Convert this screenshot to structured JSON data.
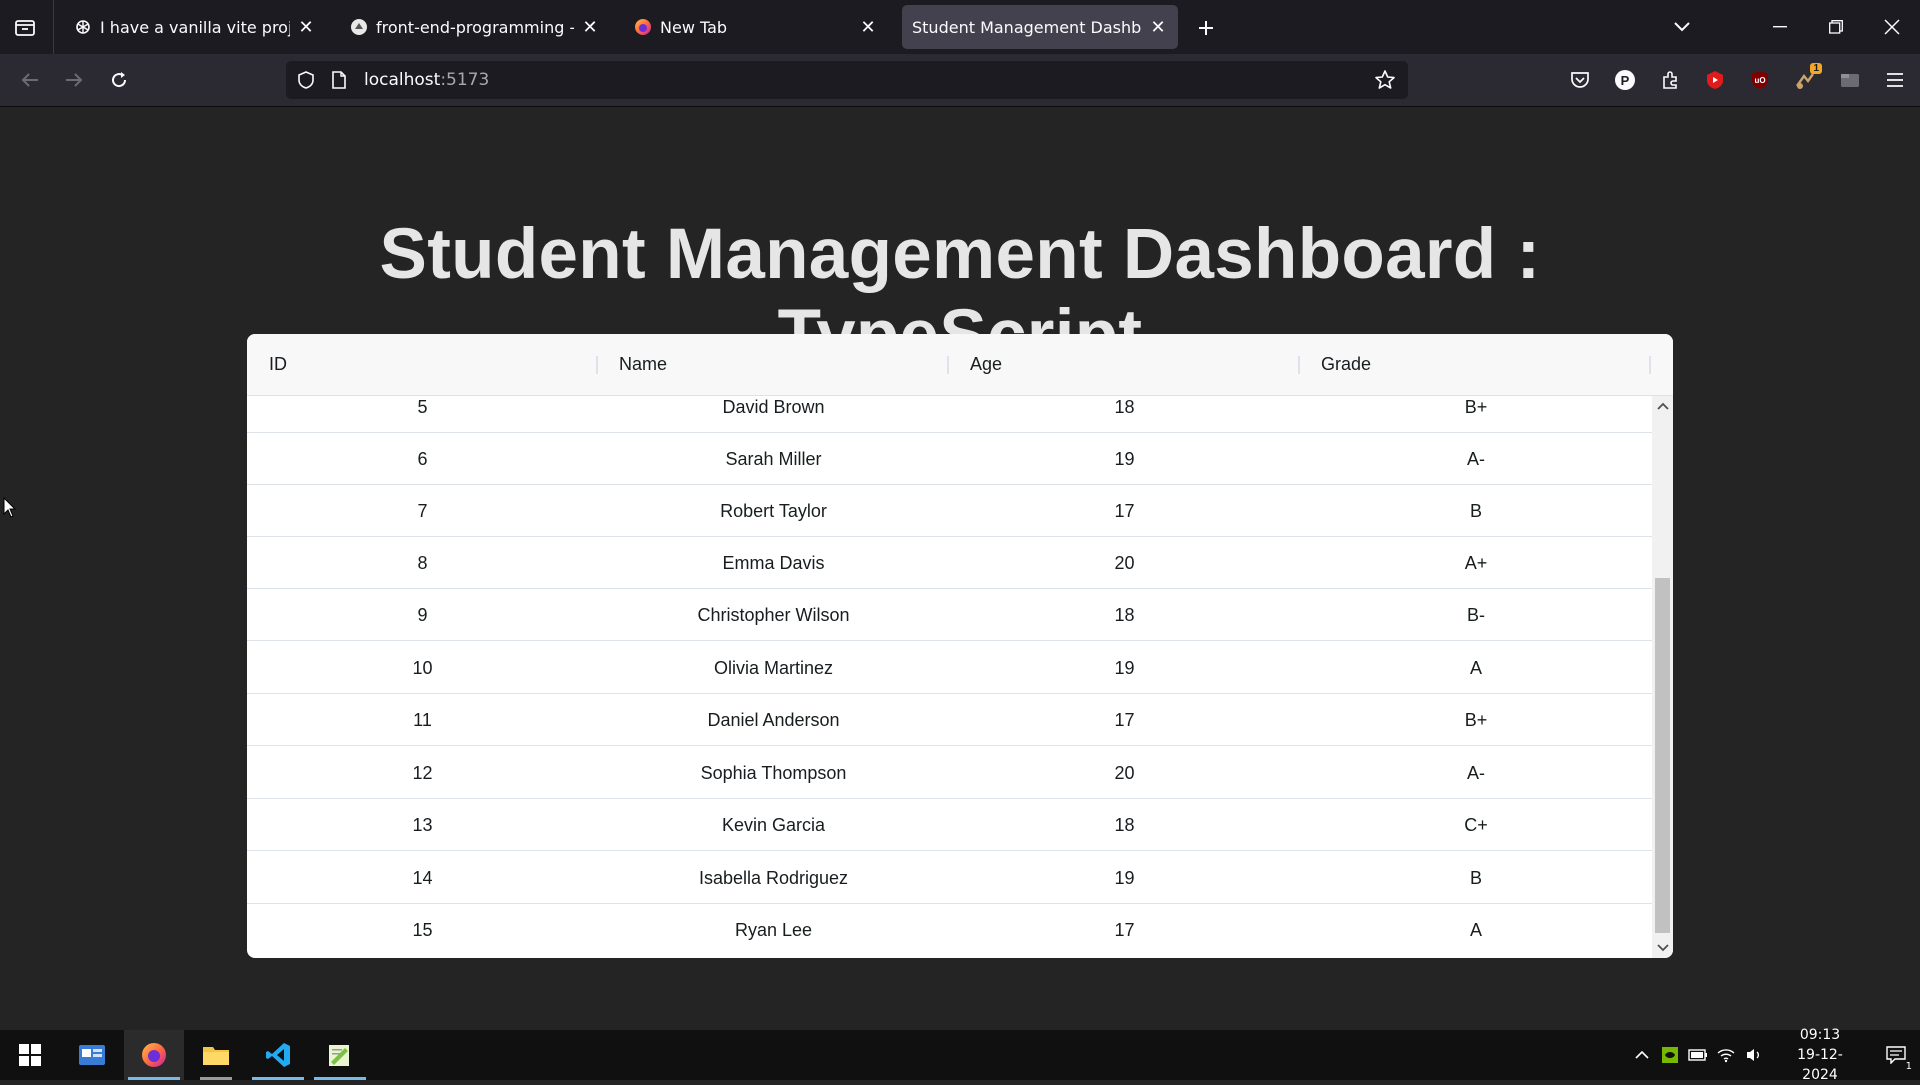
{
  "browser": {
    "tabs": [
      {
        "title": "I have a vanilla vite project. I have",
        "icon": "openai-icon",
        "active": false
      },
      {
        "title": "front-end-programming - Boo",
        "icon": "bootcamp-icon",
        "active": false
      },
      {
        "title": "New Tab",
        "icon": "firefox-icon",
        "active": false
      },
      {
        "title": "Student Management Dashboard",
        "icon": "",
        "active": true
      }
    ],
    "url_host": "localhost",
    "url_port": ":5173"
  },
  "page": {
    "title": "Student Management Dashboard : TypeScript"
  },
  "grid": {
    "columns": [
      "ID",
      "Name",
      "Age",
      "Grade"
    ],
    "rows": [
      {
        "id": "5",
        "name": "David Brown",
        "age": "18",
        "grade": "B+"
      },
      {
        "id": "6",
        "name": "Sarah Miller",
        "age": "19",
        "grade": "A-"
      },
      {
        "id": "7",
        "name": "Robert Taylor",
        "age": "17",
        "grade": "B"
      },
      {
        "id": "8",
        "name": "Emma Davis",
        "age": "20",
        "grade": "A+"
      },
      {
        "id": "9",
        "name": "Christopher Wilson",
        "age": "18",
        "grade": "B-"
      },
      {
        "id": "10",
        "name": "Olivia Martinez",
        "age": "19",
        "grade": "A"
      },
      {
        "id": "11",
        "name": "Daniel Anderson",
        "age": "17",
        "grade": "B+"
      },
      {
        "id": "12",
        "name": "Sophia Thompson",
        "age": "20",
        "grade": "A-"
      },
      {
        "id": "13",
        "name": "Kevin Garcia",
        "age": "18",
        "grade": "C+"
      },
      {
        "id": "14",
        "name": "Isabella Rodriguez",
        "age": "19",
        "grade": "B"
      },
      {
        "id": "15",
        "name": "Ryan Lee",
        "age": "17",
        "grade": "A"
      }
    ]
  },
  "toolbar_badges": {
    "extension_badge": "1"
  },
  "taskbar": {
    "apps": [
      "start-button",
      "control-panel-icon",
      "firefox-icon",
      "file-explorer-icon",
      "vscode-icon",
      "notepad-plus-icon"
    ],
    "time": "09:13",
    "date": "19-12-2024",
    "notification_count": "1"
  },
  "colors": {
    "page_background": "#242424",
    "grid_background": "#ffffff",
    "grid_header_background": "#f8f8f8",
    "browser_chrome": "#1c1b22",
    "active_tab": "#42414d"
  }
}
